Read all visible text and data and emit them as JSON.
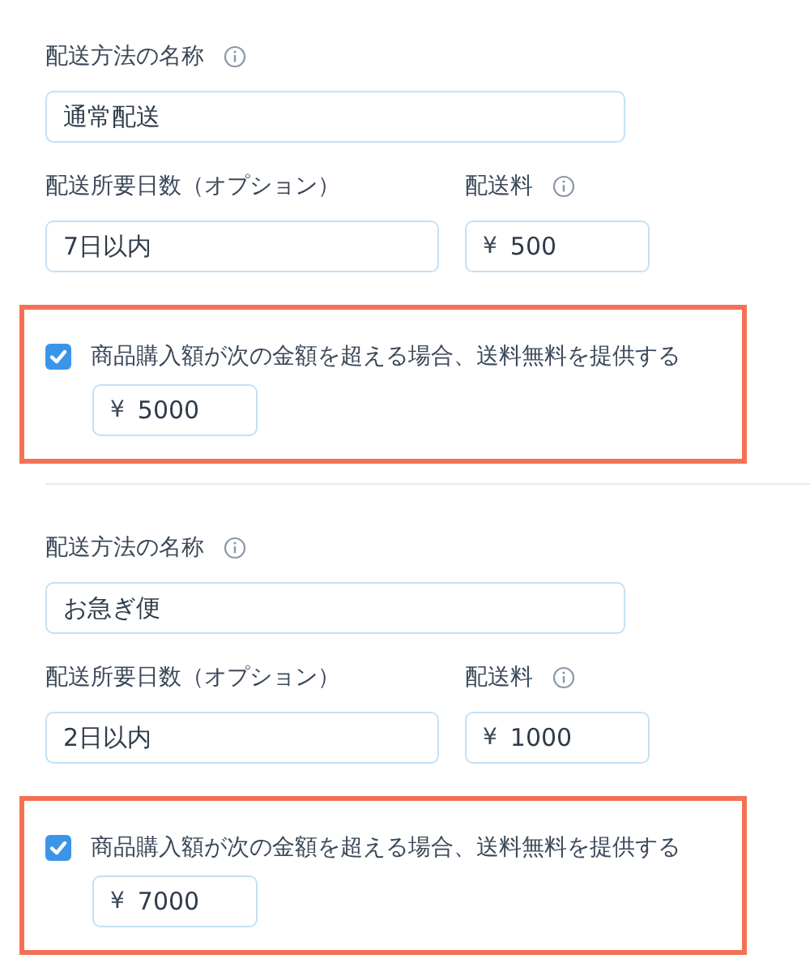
{
  "methods": [
    {
      "name_label": "配送方法の名称",
      "name_value": "通常配送",
      "days_label": "配送所要日数（オプション）",
      "days_value": "7日以内",
      "fee_label": "配送料",
      "fee_currency": "¥",
      "fee_value": "500",
      "free_shipping": {
        "checked": true,
        "highlighted": true,
        "label": "商品購入額が次の金額を超える場合、送料無料を提供する",
        "currency": "¥",
        "value": "5000"
      }
    },
    {
      "name_label": "配送方法の名称",
      "name_value": "お急ぎ便",
      "days_label": "配送所要日数（オプション）",
      "days_value": "2日以内",
      "fee_label": "配送料",
      "fee_currency": "¥",
      "fee_value": "1000",
      "free_shipping": {
        "checked": true,
        "highlighted": true,
        "label": "商品購入額が次の金額を超える場合、送料無料を提供する",
        "currency": "¥",
        "value": "7000"
      }
    }
  ]
}
